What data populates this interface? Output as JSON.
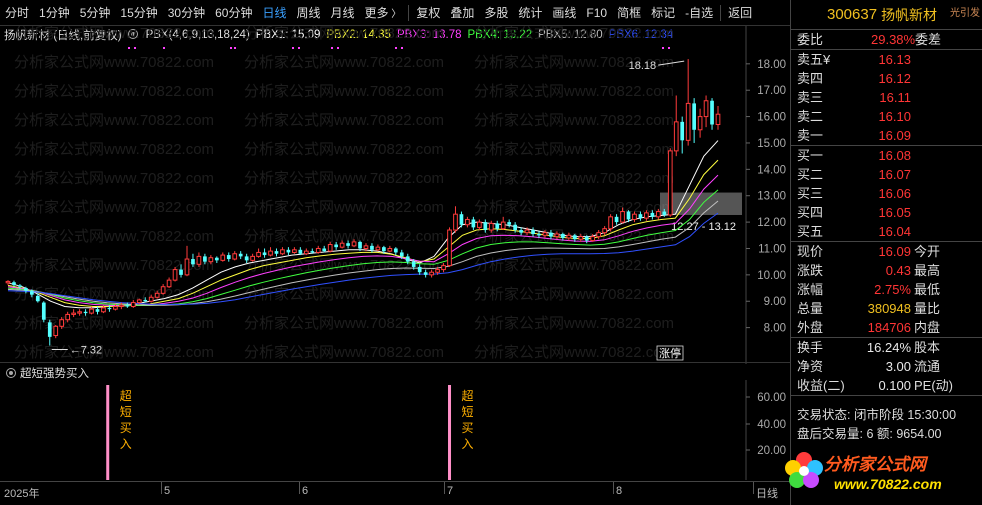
{
  "toolbar": {
    "items": [
      "分时",
      "1分钟",
      "5分钟",
      "15分钟",
      "30分钟",
      "60分钟",
      "日线",
      "周线",
      "月线",
      "更多",
      "复权",
      "叠加",
      "多股",
      "统计",
      "画线",
      "F10",
      "简框",
      "标记",
      "-自选",
      "返回"
    ],
    "active": "日线"
  },
  "indicator_header": {
    "title": "扬帆新材 (日线,前复权)",
    "formula": "PBX(4,6,9,13,18,24)",
    "pbx1": "PBX1: 15.09",
    "pbx2": "PBX2: 14.35",
    "pbx3": "PBX3: 13.78",
    "pbx4": "PBX4: 13.22",
    "pbx5": "PBX5: 12.80",
    "pbx6": "PBX6: 12.34",
    "colors": {
      "pbx1": "#ffffff",
      "pbx2": "#ffff40",
      "pbx3": "#ff40ff",
      "pbx4": "#40ff40",
      "pbx5": "#c0c0c0",
      "pbx6": "#3050ff"
    }
  },
  "main_chart": {
    "y_ticks": [
      "18.00",
      "17.00",
      "16.00",
      "15.00",
      "14.00",
      "13.00",
      "12.00",
      "11.00",
      "10.00",
      "9.00",
      "8.00"
    ],
    "high_label": "18.18",
    "low_label": "7.32",
    "box_label": "12.27 - 13.12",
    "tag": "涨停",
    "watermark": "分析家公式网www.70822.com"
  },
  "sub_chart": {
    "title": "超短强势买入",
    "y_ticks": [
      "60.00",
      "40.00",
      "20.00"
    ],
    "signal_text": "超短买入"
  },
  "x_axis": {
    "labels": [
      "2025年",
      "5",
      "6",
      "7",
      "8",
      "日线"
    ]
  },
  "quote": {
    "code": "300637",
    "name": "扬帆新材",
    "extra": "光引发",
    "weibi_label": "委比",
    "weibi_value": "29.38%",
    "weicha_label": "委差",
    "sell": [
      {
        "label": "卖五",
        "price": "16.13"
      },
      {
        "label": "卖四",
        "price": "16.12"
      },
      {
        "label": "卖三",
        "price": "16.11"
      },
      {
        "label": "卖二",
        "price": "16.10"
      },
      {
        "label": "卖一",
        "price": "16.09"
      }
    ],
    "buy": [
      {
        "label": "买一",
        "price": "16.08"
      },
      {
        "label": "买二",
        "price": "16.07"
      },
      {
        "label": "买三",
        "price": "16.06"
      },
      {
        "label": "买四",
        "price": "16.05"
      },
      {
        "label": "买五",
        "price": "16.04"
      }
    ],
    "stats": [
      {
        "l1": "现价",
        "v": "16.09",
        "l2": "今开",
        "c": "red"
      },
      {
        "l1": "涨跌",
        "v": "0.43",
        "l2": "最高",
        "c": "red"
      },
      {
        "l1": "涨幅",
        "v": "2.75%",
        "l2": "最低",
        "c": "red"
      },
      {
        "l1": "总量",
        "v": "380948",
        "l2": "量比",
        "c": "yellow"
      },
      {
        "l1": "外盘",
        "v": "184706",
        "l2": "内盘",
        "c": "red"
      }
    ],
    "stats2": [
      {
        "l1": "换手",
        "v": "16.24%",
        "l2": "股本",
        "c": "white"
      },
      {
        "l1": "净资",
        "v": "3.00",
        "l2": "流通",
        "c": "white"
      },
      {
        "l1": "收益(二)",
        "v": "0.100",
        "l2": "PE(动)",
        "c": "white"
      }
    ],
    "trade_status": "交易状态: 闭市阶段 15:30:00",
    "after_volume": "盘后交易量: 6  额: 9654.00"
  },
  "logo": {
    "text": "分析家公式网",
    "url": "www.70822.com"
  },
  "chart_data": {
    "type": "candlestick",
    "y_range": [
      7.0,
      18.6
    ],
    "candles": [
      [
        9.7,
        9.75,
        9.8,
        9.62,
        "u"
      ],
      [
        9.72,
        9.62,
        9.78,
        9.55,
        "d"
      ],
      [
        9.6,
        9.55,
        9.65,
        9.45,
        "d"
      ],
      [
        9.5,
        9.4,
        9.55,
        9.3,
        "d"
      ],
      [
        9.38,
        9.25,
        9.45,
        9.15,
        "d"
      ],
      [
        9.2,
        9.0,
        9.3,
        8.95,
        "d"
      ],
      [
        8.95,
        8.3,
        9.0,
        8.2,
        "d"
      ],
      [
        8.2,
        7.65,
        8.3,
        7.32,
        "d"
      ],
      [
        7.7,
        8.05,
        8.1,
        7.6,
        "u"
      ],
      [
        8.05,
        8.3,
        8.4,
        7.95,
        "u"
      ],
      [
        8.3,
        8.5,
        8.6,
        8.2,
        "u"
      ],
      [
        8.5,
        8.55,
        8.7,
        8.4,
        "u"
      ],
      [
        8.55,
        8.6,
        8.7,
        8.45,
        "u"
      ],
      [
        8.6,
        8.55,
        8.7,
        8.45,
        "d"
      ],
      [
        8.55,
        8.7,
        8.8,
        8.5,
        "u"
      ],
      [
        8.7,
        8.6,
        8.8,
        8.5,
        "d"
      ],
      [
        8.6,
        8.75,
        8.85,
        8.55,
        "u"
      ],
      [
        8.75,
        8.7,
        8.85,
        8.6,
        "d"
      ],
      [
        8.7,
        8.8,
        8.9,
        8.65,
        "u"
      ],
      [
        8.8,
        8.85,
        8.95,
        8.7,
        "u"
      ],
      [
        8.85,
        8.8,
        8.95,
        8.75,
        "d"
      ],
      [
        8.8,
        8.95,
        9.05,
        8.75,
        "u"
      ],
      [
        8.95,
        9.05,
        9.1,
        8.9,
        "u"
      ],
      [
        9.05,
        9.0,
        9.15,
        8.95,
        "d"
      ],
      [
        9.0,
        9.15,
        9.25,
        8.95,
        "u"
      ],
      [
        9.15,
        9.3,
        9.4,
        9.1,
        "u"
      ],
      [
        9.3,
        9.55,
        9.65,
        9.25,
        "u"
      ],
      [
        9.55,
        9.8,
        9.9,
        9.5,
        "u"
      ],
      [
        9.8,
        10.2,
        10.3,
        9.75,
        "u"
      ],
      [
        10.2,
        10.0,
        10.4,
        9.9,
        "d"
      ],
      [
        10.0,
        10.6,
        11.1,
        9.95,
        "u"
      ],
      [
        10.6,
        10.4,
        10.8,
        10.3,
        "d"
      ],
      [
        10.4,
        10.7,
        10.85,
        10.3,
        "u"
      ],
      [
        10.7,
        10.5,
        10.8,
        10.4,
        "d"
      ],
      [
        10.5,
        10.65,
        10.75,
        10.4,
        "u"
      ],
      [
        10.65,
        10.55,
        10.7,
        10.45,
        "d"
      ],
      [
        10.55,
        10.75,
        10.85,
        10.5,
        "u"
      ],
      [
        10.75,
        10.6,
        10.85,
        10.5,
        "d"
      ],
      [
        10.6,
        10.8,
        10.9,
        10.55,
        "u"
      ],
      [
        10.8,
        10.7,
        10.9,
        10.6,
        "d"
      ],
      [
        10.7,
        10.55,
        10.8,
        10.45,
        "d"
      ],
      [
        10.55,
        10.7,
        10.8,
        10.5,
        "u"
      ],
      [
        10.7,
        10.85,
        11.0,
        10.65,
        "u"
      ],
      [
        10.85,
        10.75,
        11.0,
        10.65,
        "d"
      ],
      [
        10.75,
        10.9,
        11.05,
        10.7,
        "u"
      ],
      [
        10.9,
        10.8,
        11.0,
        10.7,
        "d"
      ],
      [
        10.8,
        10.95,
        11.05,
        10.75,
        "u"
      ],
      [
        10.95,
        10.85,
        11.05,
        10.75,
        "d"
      ],
      [
        10.85,
        10.95,
        11.05,
        10.8,
        "u"
      ],
      [
        10.95,
        10.8,
        11.05,
        10.75,
        "d"
      ],
      [
        10.8,
        10.9,
        11.0,
        10.75,
        "u"
      ],
      [
        10.9,
        10.85,
        11.0,
        10.8,
        "d"
      ],
      [
        10.85,
        11.0,
        11.1,
        10.8,
        "u"
      ],
      [
        11.0,
        10.9,
        11.1,
        10.85,
        "d"
      ],
      [
        10.9,
        11.15,
        11.25,
        10.85,
        "u"
      ],
      [
        11.15,
        11.05,
        11.25,
        10.95,
        "d"
      ],
      [
        11.05,
        11.2,
        11.3,
        11.0,
        "u"
      ],
      [
        11.2,
        11.1,
        11.3,
        11.0,
        "d"
      ],
      [
        11.1,
        11.25,
        11.35,
        11.05,
        "u"
      ],
      [
        11.25,
        11.0,
        11.3,
        10.9,
        "d"
      ],
      [
        11.0,
        11.1,
        11.2,
        10.9,
        "u"
      ],
      [
        11.1,
        10.95,
        11.2,
        10.85,
        "d"
      ],
      [
        10.95,
        11.05,
        11.15,
        10.9,
        "u"
      ],
      [
        11.05,
        10.9,
        11.1,
        10.8,
        "d"
      ],
      [
        10.9,
        11.0,
        11.1,
        10.85,
        "u"
      ],
      [
        11.0,
        10.85,
        11.05,
        10.75,
        "d"
      ],
      [
        10.85,
        10.7,
        10.95,
        10.6,
        "d"
      ],
      [
        10.7,
        10.5,
        10.8,
        10.4,
        "d"
      ],
      [
        10.5,
        10.3,
        10.6,
        10.2,
        "d"
      ],
      [
        10.3,
        10.1,
        10.4,
        10.0,
        "d"
      ],
      [
        10.1,
        10.0,
        10.2,
        9.9,
        "d"
      ],
      [
        10.0,
        10.1,
        10.2,
        9.9,
        "u"
      ],
      [
        10.1,
        10.2,
        10.3,
        10.0,
        "u"
      ],
      [
        10.2,
        10.35,
        10.45,
        10.1,
        "u"
      ],
      [
        10.35,
        11.7,
        11.8,
        10.3,
        "u"
      ],
      [
        11.7,
        12.3,
        12.6,
        11.6,
        "u"
      ],
      [
        12.3,
        11.9,
        12.4,
        11.8,
        "d"
      ],
      [
        11.9,
        12.1,
        12.2,
        11.8,
        "u"
      ],
      [
        12.1,
        11.8,
        12.2,
        11.7,
        "d"
      ],
      [
        11.8,
        12.0,
        12.1,
        11.7,
        "u"
      ],
      [
        12.0,
        11.7,
        12.1,
        11.6,
        "d"
      ],
      [
        11.7,
        11.95,
        12.05,
        11.6,
        "u"
      ],
      [
        11.95,
        11.75,
        12.05,
        11.65,
        "d"
      ],
      [
        11.75,
        12.0,
        12.2,
        11.7,
        "u"
      ],
      [
        12.0,
        11.9,
        12.1,
        11.8,
        "d"
      ],
      [
        11.9,
        11.7,
        12.0,
        11.6,
        "d"
      ],
      [
        11.7,
        11.6,
        11.8,
        11.5,
        "d"
      ],
      [
        11.6,
        11.7,
        11.8,
        11.5,
        "u"
      ],
      [
        11.7,
        11.55,
        11.8,
        11.45,
        "d"
      ],
      [
        11.55,
        11.5,
        11.65,
        11.4,
        "d"
      ],
      [
        11.5,
        11.6,
        11.7,
        11.4,
        "u"
      ],
      [
        11.6,
        11.45,
        11.7,
        11.35,
        "d"
      ],
      [
        11.45,
        11.55,
        11.65,
        11.35,
        "u"
      ],
      [
        11.55,
        11.4,
        11.6,
        11.3,
        "d"
      ],
      [
        11.4,
        11.5,
        11.6,
        11.3,
        "u"
      ],
      [
        11.5,
        11.35,
        11.55,
        11.25,
        "d"
      ],
      [
        11.35,
        11.45,
        11.55,
        11.25,
        "u"
      ],
      [
        11.45,
        11.3,
        11.5,
        11.2,
        "d"
      ],
      [
        11.3,
        11.45,
        11.55,
        11.25,
        "u"
      ],
      [
        11.45,
        11.6,
        11.7,
        11.35,
        "u"
      ],
      [
        11.6,
        11.75,
        11.85,
        11.5,
        "u"
      ],
      [
        11.75,
        12.2,
        12.3,
        11.65,
        "u"
      ],
      [
        12.2,
        12.0,
        12.3,
        11.9,
        "d"
      ],
      [
        12.0,
        12.4,
        12.55,
        11.95,
        "u"
      ],
      [
        12.4,
        12.1,
        12.45,
        12.0,
        "d"
      ],
      [
        12.1,
        12.3,
        12.4,
        12.0,
        "u"
      ],
      [
        12.3,
        12.15,
        12.4,
        12.05,
        "d"
      ],
      [
        12.15,
        12.35,
        12.45,
        12.05,
        "u"
      ],
      [
        12.35,
        12.2,
        12.45,
        12.1,
        "d"
      ],
      [
        12.2,
        12.4,
        12.5,
        12.1,
        "u"
      ],
      [
        12.4,
        12.27,
        12.5,
        12.2,
        "d"
      ],
      [
        12.27,
        14.7,
        14.8,
        12.2,
        "u"
      ],
      [
        14.7,
        15.8,
        16.8,
        14.5,
        "u"
      ],
      [
        15.8,
        15.1,
        16.0,
        14.6,
        "d"
      ],
      [
        15.1,
        16.5,
        18.18,
        14.9,
        "u"
      ],
      [
        16.5,
        15.5,
        16.7,
        15.0,
        "d"
      ],
      [
        15.5,
        16.0,
        16.3,
        15.2,
        "u"
      ],
      [
        16.0,
        16.6,
        16.8,
        15.6,
        "u"
      ],
      [
        16.6,
        15.7,
        16.7,
        15.5,
        "d"
      ],
      [
        15.7,
        16.09,
        16.4,
        15.5,
        "u"
      ]
    ],
    "series": [
      {
        "name": "PBX1",
        "values": [
          9.7,
          9.55,
          9.3,
          9.0,
          8.8,
          8.75,
          8.75,
          8.8,
          8.85,
          8.9,
          9.0,
          9.1,
          9.25,
          9.5,
          9.8,
          10.1,
          10.3,
          10.45,
          10.55,
          10.65,
          10.75,
          10.8,
          10.85,
          10.9,
          10.95,
          10.95,
          10.9,
          10.8,
          10.6,
          10.45,
          10.7,
          11.4,
          11.9,
          12.0,
          11.95,
          11.9,
          11.8,
          11.7,
          11.6,
          11.5,
          11.45,
          11.45,
          11.6,
          11.9,
          12.1,
          12.2,
          12.25,
          12.3,
          13.4,
          14.5,
          15.09
        ]
      },
      {
        "name": "PBX2",
        "values": [
          9.6,
          9.5,
          9.35,
          9.15,
          8.95,
          8.85,
          8.8,
          8.8,
          8.82,
          8.85,
          8.9,
          9.0,
          9.1,
          9.3,
          9.55,
          9.8,
          10.0,
          10.2,
          10.35,
          10.45,
          10.55,
          10.65,
          10.72,
          10.78,
          10.82,
          10.85,
          10.85,
          10.78,
          10.65,
          10.5,
          10.6,
          11.05,
          11.5,
          11.7,
          11.75,
          11.72,
          11.65,
          11.58,
          11.5,
          11.42,
          11.38,
          11.38,
          11.48,
          11.7,
          11.9,
          12.02,
          12.1,
          12.15,
          12.9,
          13.8,
          14.35
        ]
      },
      {
        "name": "PBX3",
        "values": [
          9.55,
          9.48,
          9.38,
          9.22,
          9.05,
          8.95,
          8.88,
          8.85,
          8.84,
          8.84,
          8.86,
          8.92,
          9.0,
          9.12,
          9.3,
          9.52,
          9.72,
          9.9,
          10.05,
          10.18,
          10.3,
          10.4,
          10.5,
          10.58,
          10.65,
          10.7,
          10.72,
          10.7,
          10.62,
          10.52,
          10.5,
          10.8,
          11.15,
          11.38,
          11.48,
          11.5,
          11.48,
          11.44,
          11.38,
          11.32,
          11.28,
          11.27,
          11.33,
          11.48,
          11.65,
          11.78,
          11.88,
          11.95,
          12.5,
          13.25,
          13.78
        ]
      },
      {
        "name": "PBX4",
        "values": [
          9.5,
          9.45,
          9.38,
          9.26,
          9.12,
          9.02,
          8.94,
          8.89,
          8.86,
          8.84,
          8.84,
          8.86,
          8.9,
          8.98,
          9.1,
          9.26,
          9.42,
          9.58,
          9.72,
          9.85,
          9.97,
          10.08,
          10.18,
          10.27,
          10.35,
          10.42,
          10.47,
          10.49,
          10.47,
          10.42,
          10.4,
          10.55,
          10.8,
          11.02,
          11.15,
          11.22,
          11.25,
          11.25,
          11.22,
          11.18,
          11.15,
          11.13,
          11.16,
          11.25,
          11.38,
          11.5,
          11.6,
          11.68,
          12.1,
          12.75,
          13.22
        ]
      },
      {
        "name": "PBX5",
        "values": [
          9.45,
          9.42,
          9.37,
          9.28,
          9.17,
          9.08,
          9.0,
          8.94,
          8.9,
          8.87,
          8.85,
          8.85,
          8.87,
          8.91,
          8.98,
          9.08,
          9.2,
          9.33,
          9.46,
          9.58,
          9.7,
          9.8,
          9.9,
          9.99,
          10.07,
          10.14,
          10.2,
          10.24,
          10.26,
          10.25,
          10.24,
          10.32,
          10.5,
          10.7,
          10.83,
          10.92,
          10.98,
          11.01,
          11.02,
          11.01,
          11.0,
          10.99,
          11.0,
          11.06,
          11.15,
          11.25,
          11.35,
          11.43,
          11.8,
          12.35,
          12.8
        ]
      },
      {
        "name": "PBX6",
        "values": [
          9.4,
          9.38,
          9.35,
          9.29,
          9.21,
          9.13,
          9.06,
          9.0,
          8.95,
          8.92,
          8.89,
          8.88,
          8.88,
          8.89,
          8.92,
          8.98,
          9.06,
          9.16,
          9.26,
          9.36,
          9.46,
          9.55,
          9.64,
          9.72,
          9.8,
          9.87,
          9.93,
          9.98,
          10.01,
          10.03,
          10.03,
          10.08,
          10.2,
          10.36,
          10.5,
          10.6,
          10.68,
          10.74,
          10.78,
          10.8,
          10.8,
          10.8,
          10.81,
          10.84,
          10.9,
          10.98,
          11.06,
          11.14,
          11.45,
          11.95,
          12.34
        ]
      }
    ],
    "signals": [
      8,
      74
    ]
  }
}
